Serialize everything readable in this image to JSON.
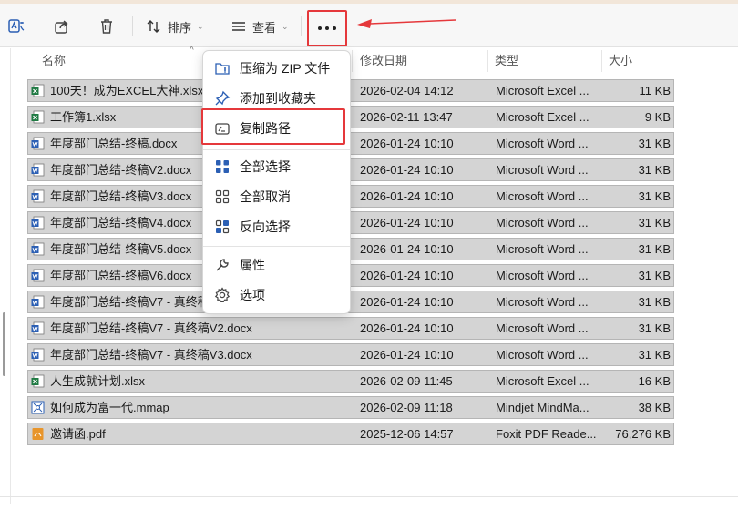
{
  "toolbar": {
    "sort_label": "排序",
    "view_label": "查看",
    "caret": "⌄",
    "icons": [
      "translate-icon",
      "share-icon",
      "trash-icon",
      "sort-icon",
      "view-icon",
      "more-icon"
    ]
  },
  "columns": {
    "name": "名称",
    "modified": "修改日期",
    "type": "类型",
    "size": "大小"
  },
  "files": [
    {
      "name": "100天！成为EXCEL大神.xlsx",
      "date": "2026-02-04 14:12",
      "type": "Microsoft Excel ...",
      "size": "11 KB",
      "kind": "excel"
    },
    {
      "name": "工作簿1.xlsx",
      "date": "2026-02-11 13:47",
      "type": "Microsoft Excel ...",
      "size": "9 KB",
      "kind": "excel"
    },
    {
      "name": "年度部门总结-终稿.docx",
      "date": "2026-01-24 10:10",
      "type": "Microsoft Word ...",
      "size": "31 KB",
      "kind": "word"
    },
    {
      "name": "年度部门总结-终稿V2.docx",
      "date": "2026-01-24 10:10",
      "type": "Microsoft Word ...",
      "size": "31 KB",
      "kind": "word"
    },
    {
      "name": "年度部门总结-终稿V3.docx",
      "date": "2026-01-24 10:10",
      "type": "Microsoft Word ...",
      "size": "31 KB",
      "kind": "word"
    },
    {
      "name": "年度部门总结-终稿V4.docx",
      "date": "2026-01-24 10:10",
      "type": "Microsoft Word ...",
      "size": "31 KB",
      "kind": "word"
    },
    {
      "name": "年度部门总结-终稿V5.docx",
      "date": "2026-01-24 10:10",
      "type": "Microsoft Word ...",
      "size": "31 KB",
      "kind": "word"
    },
    {
      "name": "年度部门总结-终稿V6.docx",
      "date": "2026-01-24 10:10",
      "type": "Microsoft Word ...",
      "size": "31 KB",
      "kind": "word"
    },
    {
      "name": "年度部门总结-终稿V7 - 真终稿.docx",
      "date": "2026-01-24 10:10",
      "type": "Microsoft Word ...",
      "size": "31 KB",
      "kind": "word"
    },
    {
      "name": "年度部门总结-终稿V7 - 真终稿V2.docx",
      "date": "2026-01-24 10:10",
      "type": "Microsoft Word ...",
      "size": "31 KB",
      "kind": "word"
    },
    {
      "name": "年度部门总结-终稿V7 - 真终稿V3.docx",
      "date": "2026-01-24 10:10",
      "type": "Microsoft Word ...",
      "size": "31 KB",
      "kind": "word"
    },
    {
      "name": "人生成就计划.xlsx",
      "date": "2026-02-09 11:45",
      "type": "Microsoft Excel ...",
      "size": "16 KB",
      "kind": "excel"
    },
    {
      "name": "如何成为富一代.mmap",
      "date": "2026-02-09 11:18",
      "type": "Mindjet MindMa...",
      "size": "38 KB",
      "kind": "mindmap"
    },
    {
      "name": "邀请函.pdf",
      "date": "2025-12-06 14:57",
      "type": "Foxit PDF Reade...",
      "size": "76,276 KB",
      "kind": "pdf"
    }
  ],
  "menu": {
    "items": [
      {
        "label": "压缩为 ZIP 文件",
        "icon": "zip-folder-icon"
      },
      {
        "label": "添加到收藏夹",
        "icon": "pin-icon"
      },
      {
        "label": "复制路径",
        "icon": "copy-path-icon"
      },
      {
        "label": "全部选择",
        "icon": "select-all-icon"
      },
      {
        "label": "全部取消",
        "icon": "select-none-icon"
      },
      {
        "label": "反向选择",
        "icon": "invert-selection-icon"
      },
      {
        "label": "属性",
        "icon": "wrench-icon"
      },
      {
        "label": "选项",
        "icon": "gear-icon"
      }
    ]
  },
  "colors": {
    "highlight": "#e5383b",
    "selected_row": "#d4d4d4",
    "excel": "#1f7a43",
    "word": "#2b5fb4",
    "pdf": "#e8952b"
  }
}
